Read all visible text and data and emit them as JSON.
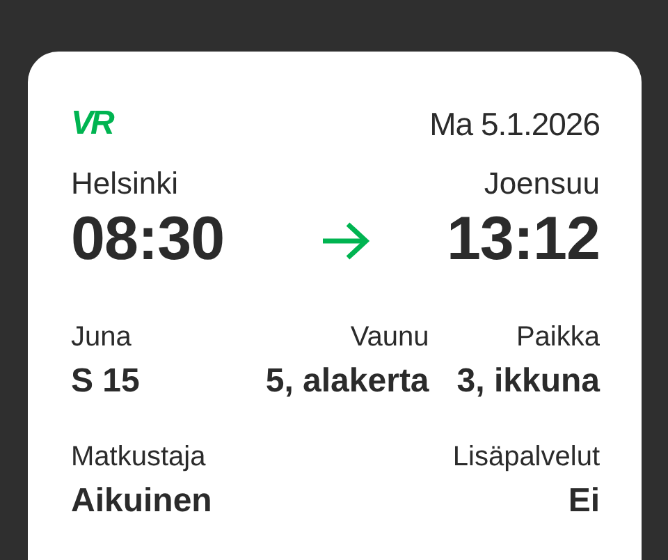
{
  "logo": "VR",
  "date": "Ma 5.1.2026",
  "route": {
    "from": {
      "station": "Helsinki",
      "time": "08:30"
    },
    "to": {
      "station": "Joensuu",
      "time": "13:12"
    }
  },
  "detail_rows": [
    [
      {
        "label": "Juna",
        "value": "S 15"
      },
      {
        "label": "Vaunu",
        "value": "5, alakerta"
      },
      {
        "label": "Paikka",
        "value": "3, ikkuna"
      }
    ],
    [
      {
        "label": "Matkustaja",
        "value": "Aikuinen"
      },
      {
        "label": "Lisäpalvelut",
        "value": "Ei"
      }
    ]
  ]
}
